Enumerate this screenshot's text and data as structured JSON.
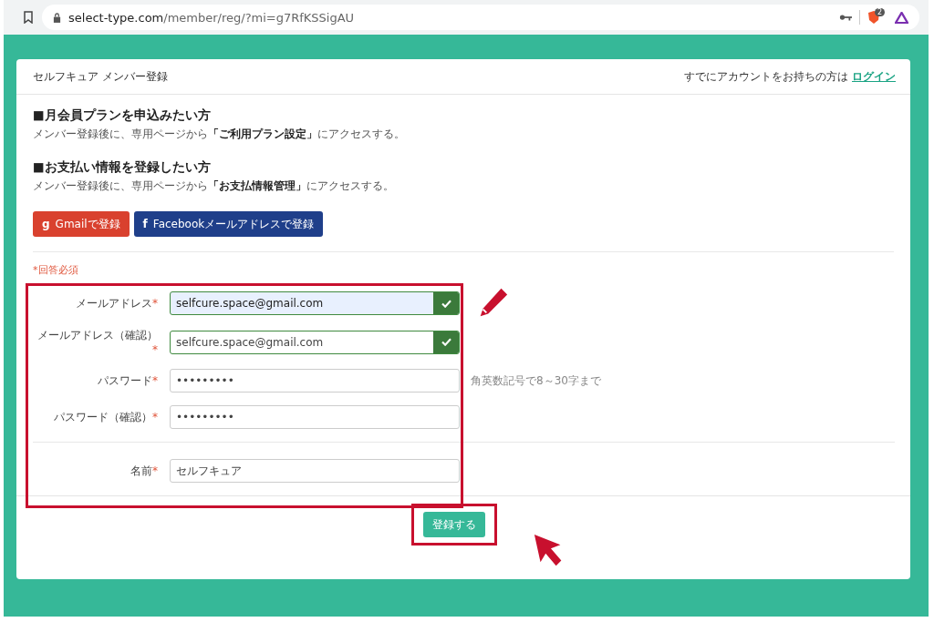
{
  "browser": {
    "url_domain": "select-type.com",
    "url_path": "/member/reg/?mi=g7RfKSSigAU",
    "shield_badge": "2"
  },
  "header": {
    "title": "セルフキュア メンバー登録",
    "login_prompt": "すでにアカウントをお持ちの方は",
    "login_link": "ログイン"
  },
  "sections": [
    {
      "heading": "■月会員プランを申込みたい方",
      "text": "メンバー登録後に、専用ページから**「ご利用プラン設定」**にアクセスする。"
    },
    {
      "heading": "■お支払い情報を登録したい方",
      "text": "メンバー登録後に、専用ページから**「お支払情報管理」**にアクセスする。"
    }
  ],
  "social_buttons": [
    {
      "kind": "google",
      "icon": "g",
      "label": "Gmailで登録"
    },
    {
      "kind": "facebook",
      "icon": "f",
      "label": "Facebookメールアドレスで登録"
    }
  ],
  "required_note": "*回答必須",
  "fields": [
    {
      "label": "メールアドレス",
      "required_mark": "*",
      "value": "selfcure.space@gmail.com",
      "valid": true,
      "autofilled": true
    },
    {
      "label": "メールアドレス（確認）",
      "required_mark": "*",
      "value": "selfcure.space@gmail.com",
      "valid": true,
      "autofilled": false
    },
    {
      "label": "パスワード",
      "required_mark": "*",
      "value": "•••••••••",
      "valid": false,
      "autofilled": false,
      "hint": "角英数記号で8～30字まで"
    },
    {
      "label": "パスワード（確認）",
      "required_mark": "*",
      "value": "•••••••••",
      "valid": false,
      "autofilled": false
    },
    {
      "label": "名前",
      "required_mark": "*",
      "value": "セルフキュア",
      "valid": false,
      "autofilled": false,
      "divider_before": true
    }
  ],
  "submit": {
    "label": "登録する"
  }
}
